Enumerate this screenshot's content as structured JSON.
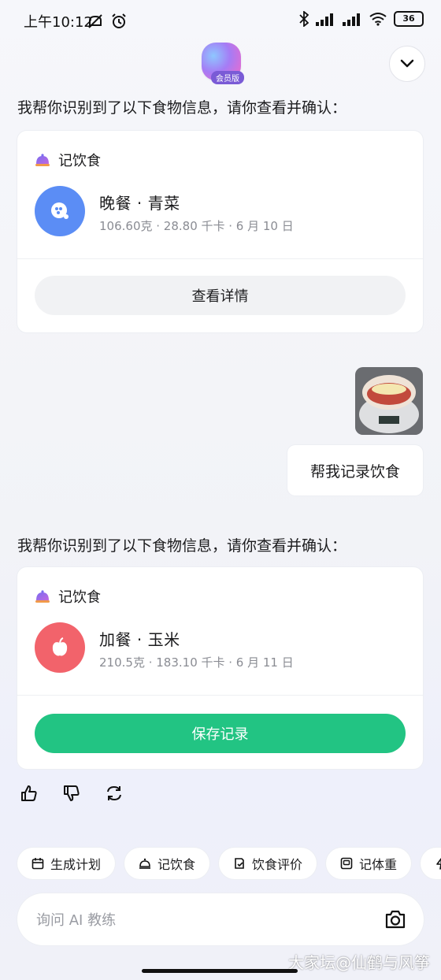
{
  "status_bar": {
    "time": "上午10:12",
    "battery": "36"
  },
  "header": {
    "badge": "会员版"
  },
  "messages": [
    {
      "prompt": "我帮你识别到了以下食物信息，请你查看并确认：",
      "card": {
        "title": "记饮食",
        "food": "晚餐 · 青菜",
        "meta": "106.60克 · 28.80 千卡 · 6 月 10 日",
        "button": "查看详情",
        "avatar_color": "#5b8df5"
      }
    },
    {
      "user_text": "帮我记录饮食"
    },
    {
      "prompt": "我帮你识别到了以下食物信息，请你查看并确认：",
      "card": {
        "title": "记饮食",
        "food": "加餐 · 玉米",
        "meta": "210.5克 · 183.10 千卡 · 6 月 11 日",
        "button": "保存记录",
        "avatar_color": "#f2636b",
        "button_color": "#22c483"
      }
    }
  ],
  "quick_actions": [
    "生成计划",
    "记饮食",
    "饮食评价",
    "记体重"
  ],
  "input": {
    "placeholder": "询问 AI 教练"
  },
  "watermark": "大家坛@仙鹤与风筝",
  "icons": {
    "card": "dining-cloche-icon",
    "camera": "camera-icon",
    "like": "thumbs-up-icon",
    "dislike": "thumbs-down-icon",
    "regenerate": "refresh-icon"
  }
}
